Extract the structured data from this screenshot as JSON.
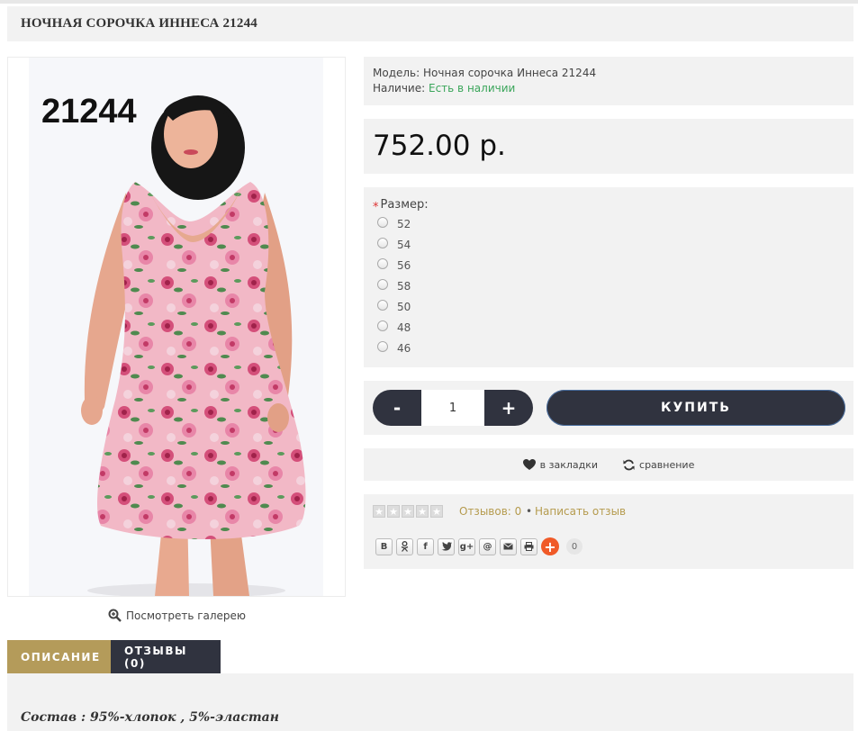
{
  "product": {
    "title": "НОЧНАЯ СОРОЧКА ИННЕСА 21244",
    "image_badge": "21244",
    "gallery_label": "Посмотреть галерею",
    "model_label": "Модель:",
    "model_value": "Ночная сорочка Иннеса 21244",
    "availability_label": "Наличие:",
    "availability_value": "Есть в наличии",
    "price": "752.00 р."
  },
  "options": {
    "required_mark": "*",
    "size_label": "Размер:",
    "sizes": [
      "52",
      "54",
      "56",
      "58",
      "50",
      "48",
      "46"
    ]
  },
  "cart": {
    "minus_label": "-",
    "plus_label": "+",
    "quantity": "1",
    "buy_label": "КУПИТЬ"
  },
  "actions": {
    "bookmark_label": "в закладки",
    "compare_label": "сравнение"
  },
  "rating": {
    "stars": 0,
    "reviews_label": "Отзывов: 0",
    "separator": "•",
    "write_review_label": "Написать отзыв"
  },
  "share": {
    "buttons": [
      "В",
      "ок",
      "f",
      "twitter",
      "g+",
      "@",
      "mail",
      "print"
    ],
    "count": "0"
  },
  "tabs": [
    {
      "label": "ОПИСАНИЕ",
      "active": true
    },
    {
      "label": "ОТЗЫВЫ (0)",
      "active": false
    }
  ],
  "description": {
    "text": "Состав : 95%-хлопок , 5%-эластан"
  },
  "colors": {
    "accent_gold": "#b49b5a",
    "dark_button": "#30333f",
    "in_stock_green": "#3aa55a",
    "link_gold": "#b59b4e",
    "share_plus": "#f05a28"
  }
}
